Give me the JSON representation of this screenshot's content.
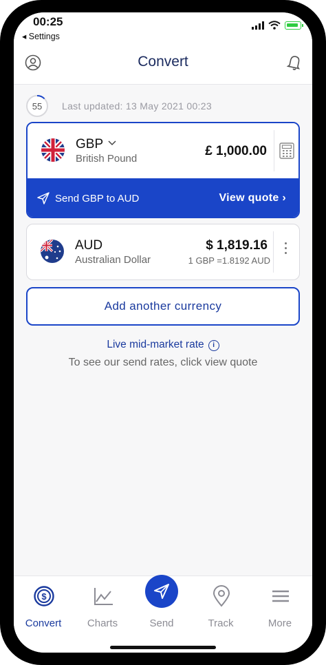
{
  "status_bar": {
    "time": "00:25",
    "back_label": "◂ Settings"
  },
  "header": {
    "title": "Convert"
  },
  "refresh": {
    "countdown": "55",
    "last_updated": "Last updated: 13 May 2021 00:23"
  },
  "source_currency": {
    "code": "GBP",
    "name": "British Pound",
    "amount": "£ 1,000.00",
    "send_label": "Send GBP to AUD",
    "view_quote_label": "View quote ›"
  },
  "target_currency": {
    "code": "AUD",
    "name": "Australian Dollar",
    "amount": "$ 1,819.16",
    "rate": "1 GBP =1.8192 AUD"
  },
  "add_currency_label": "Add another currency",
  "rate_info": {
    "live_label": "Live mid-market rate",
    "hint": "To see our send rates, click view quote"
  },
  "tabs": [
    {
      "label": "Convert",
      "icon": "currency-circle-icon",
      "active": true
    },
    {
      "label": "Charts",
      "icon": "line-chart-icon"
    },
    {
      "label": "Send",
      "icon": "paper-plane-icon"
    },
    {
      "label": "Track",
      "icon": "location-pin-icon"
    },
    {
      "label": "More",
      "icon": "menu-icon"
    }
  ],
  "colors": {
    "brand_blue": "#1a45c8",
    "navy_text": "#1a3a9e",
    "battery_green": "#2ecc40"
  }
}
